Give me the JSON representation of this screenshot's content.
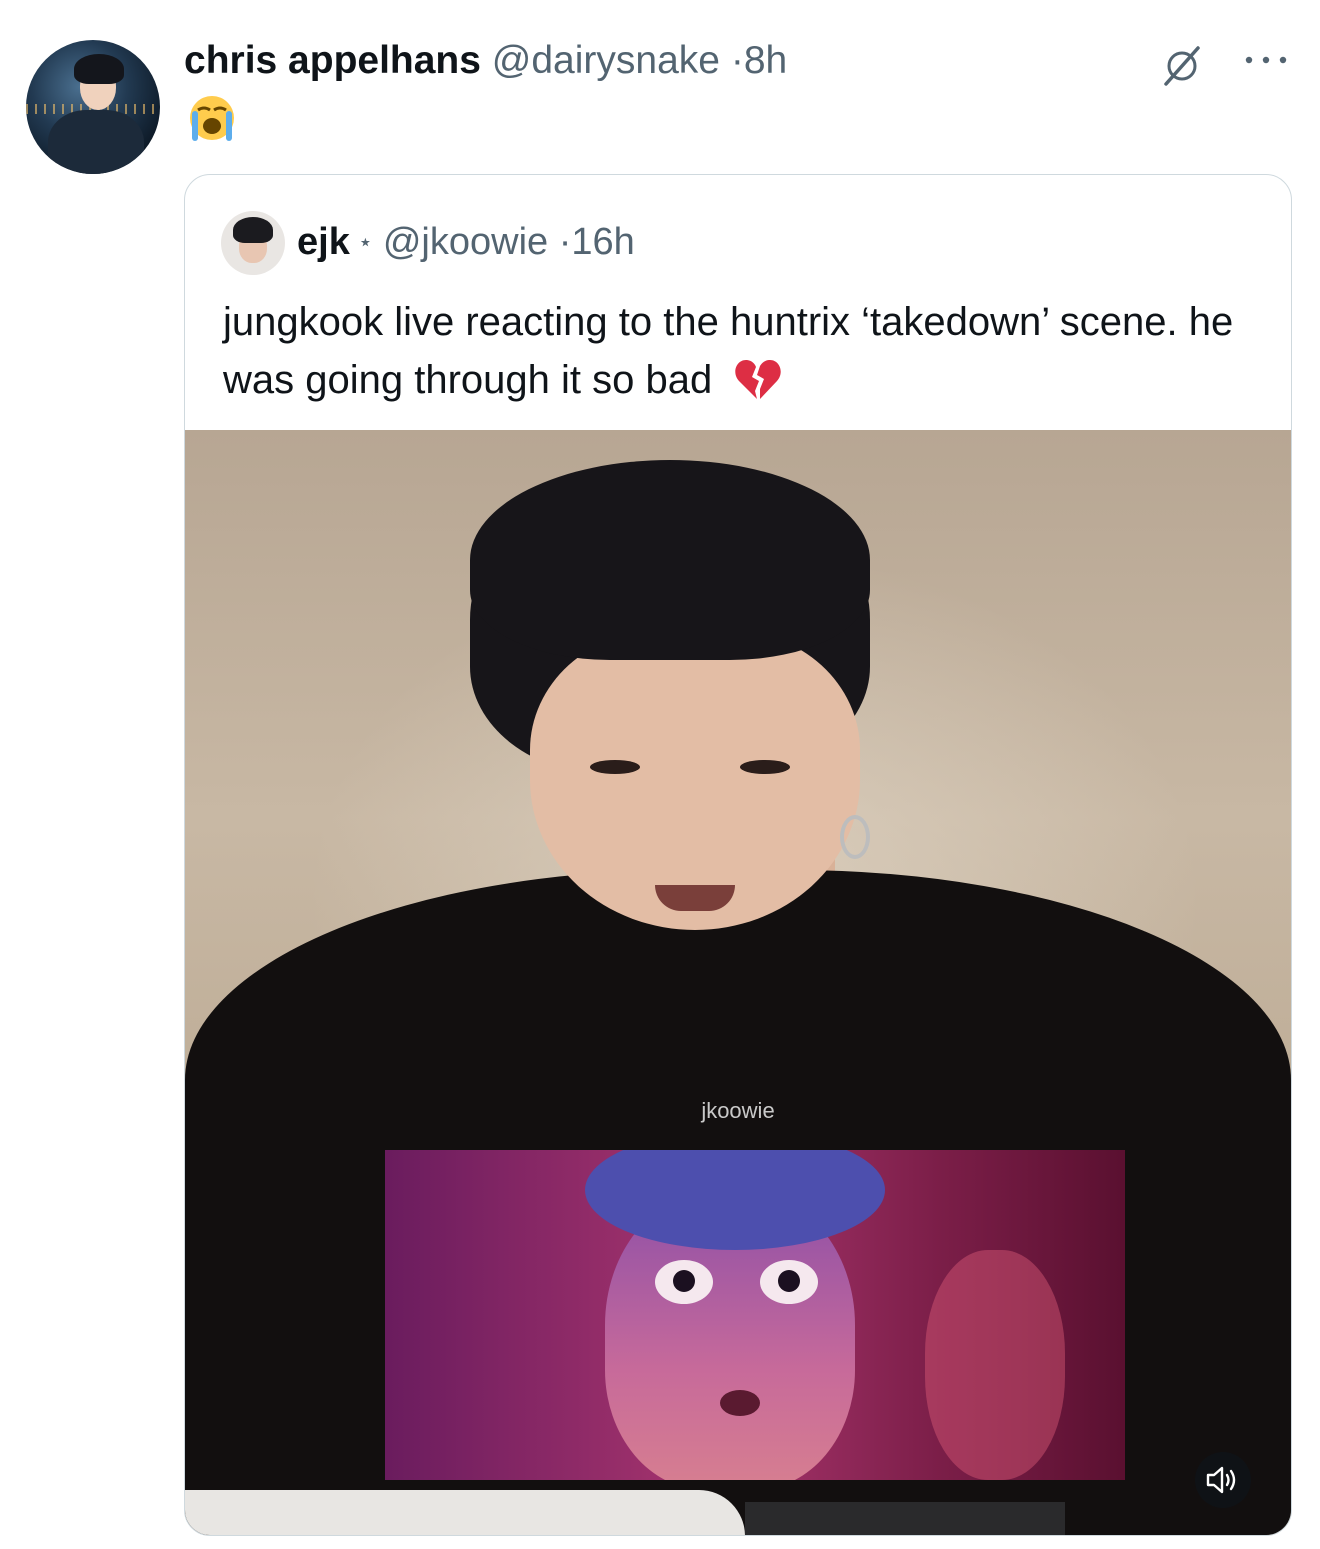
{
  "tweet": {
    "display_name": "chris appelhans",
    "handle": "@dairysnake",
    "separator": "·",
    "time": "8h",
    "emoji": "loudly-crying-face"
  },
  "quoted": {
    "display_name": "ejk",
    "star": "⋆",
    "handle": "@jkoowie",
    "separator": "·",
    "time": "16h",
    "text": "jungkook live reacting to the huntrix ‘takedown’ scene. he was going through it so bad",
    "text_emoji": "broken-heart",
    "media": {
      "watermark": "jkoowie",
      "volume_icon": "speaker-icon"
    }
  },
  "icons": {
    "grok": "grok-icon",
    "more": "more-icon"
  },
  "colors": {
    "text_primary": "#0f1419",
    "text_secondary": "#536471",
    "border": "#cfd9de"
  }
}
